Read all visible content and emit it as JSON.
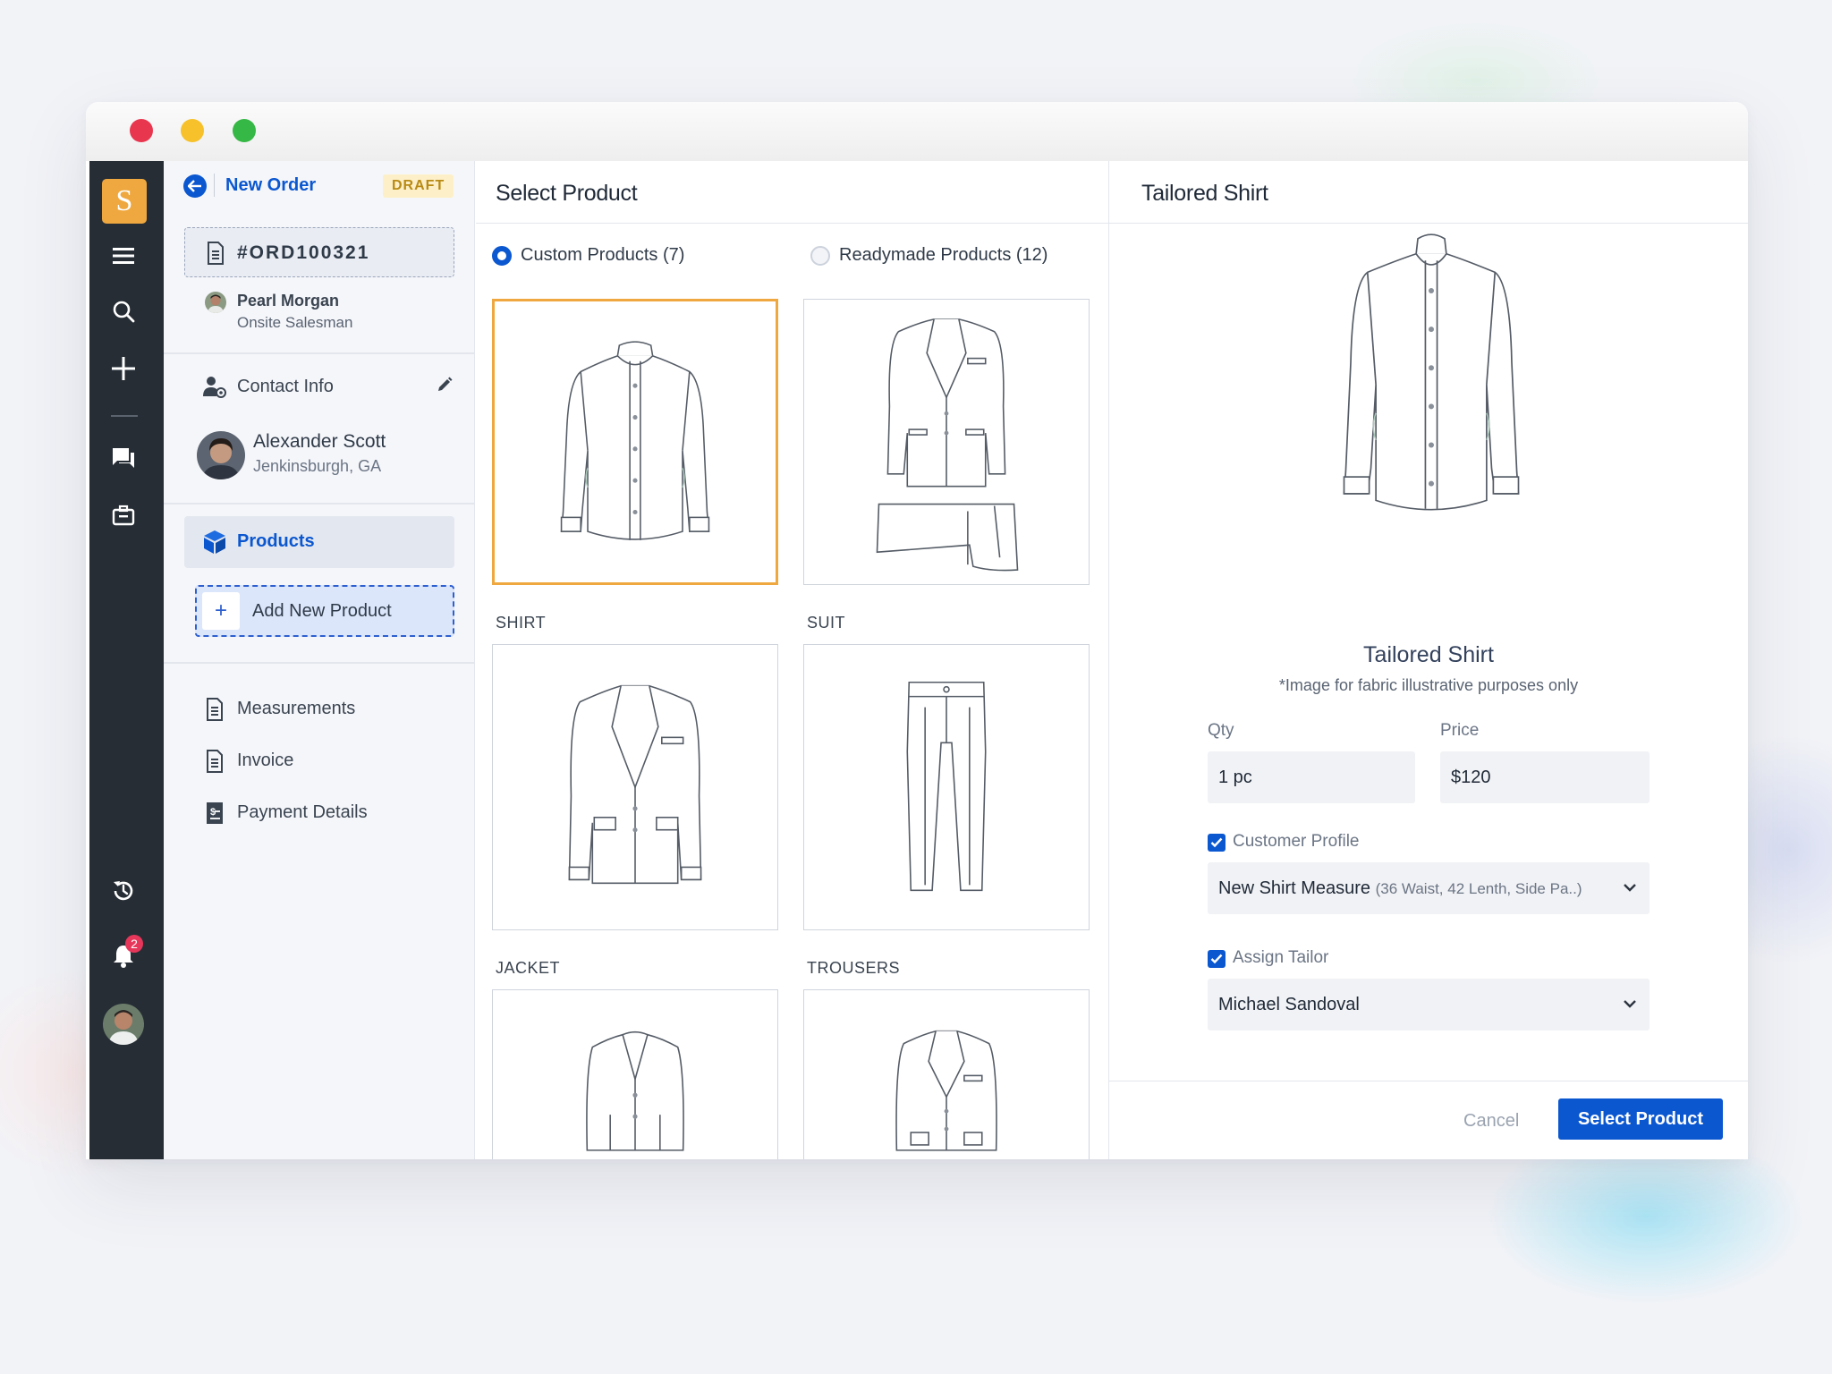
{
  "window": {
    "logo_letter": "S"
  },
  "rail": {
    "notification_count": "2"
  },
  "order": {
    "back_label": "New Order",
    "status": "DRAFT",
    "id": "#ORD100321",
    "salesman_name": "Pearl Morgan",
    "salesman_role": "Onsite Salesman"
  },
  "sidebar": {
    "contact_label": "Contact Info",
    "customer_name": "Alexander Scott",
    "customer_location": "Jenkinsburgh, GA",
    "products_label": "Products",
    "add_product_label": "Add New Product",
    "items": [
      {
        "label": "Measurements"
      },
      {
        "label": "Invoice"
      },
      {
        "label": "Payment Details"
      }
    ]
  },
  "select_product": {
    "title": "Select Product",
    "options": [
      {
        "label": "Custom Products (7)",
        "selected": true
      },
      {
        "label": "Readymade Products (12)",
        "selected": false
      }
    ],
    "products": [
      {
        "label": "SHIRT",
        "selected": true
      },
      {
        "label": "SUIT",
        "selected": false
      },
      {
        "label": "JACKET",
        "selected": false
      },
      {
        "label": "TROUSERS",
        "selected": false
      },
      {
        "label": "",
        "selected": false
      },
      {
        "label": "",
        "selected": false
      }
    ]
  },
  "detail": {
    "title": "Tailored Shirt",
    "product_name": "Tailored Shirt",
    "note": "*Image for fabric illustrative purposes only",
    "qty_label": "Qty",
    "qty_value": "1 pc",
    "price_label": "Price",
    "price_value": "$120",
    "customer_profile_label": "Customer Profile",
    "customer_profile_value": "New Shirt Measure",
    "customer_profile_detail": "(36 Waist, 42 Lenth, Side Pa..)",
    "assign_tailor_label": "Assign Tailor",
    "assign_tailor_value": "Michael Sandoval",
    "cancel_label": "Cancel",
    "submit_label": "Select Product"
  },
  "colors": {
    "accent": "#0b57d0",
    "rail": "#262d35",
    "logo": "#efa83f",
    "draft_bg": "#fdf0c8",
    "selected_border": "#efa83f",
    "badge": "#e6375a"
  }
}
